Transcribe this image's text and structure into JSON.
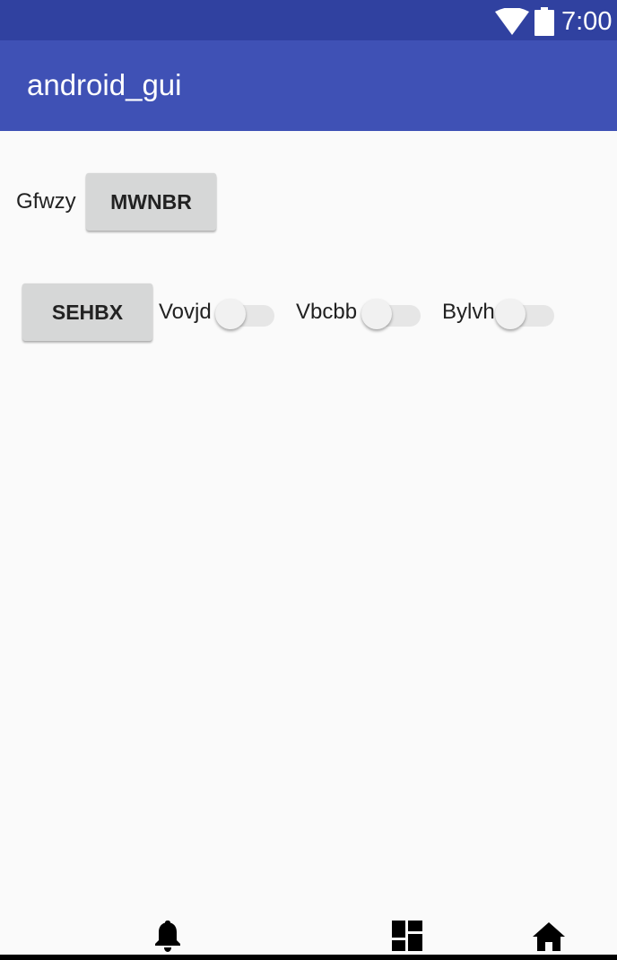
{
  "status_bar": {
    "time": "7:00",
    "icons": [
      "wifi-icon",
      "battery-icon"
    ],
    "color": "#3041a0"
  },
  "app_bar": {
    "title": "android_gui",
    "color": "#3f51b5"
  },
  "row1": {
    "label": "Gfwzy",
    "button": "MWNBR"
  },
  "row2": {
    "button": "SEHBX",
    "switches": [
      {
        "label": "Vovjd",
        "checked": false
      },
      {
        "label": "Vbcbb",
        "checked": false
      },
      {
        "label": "Bylvh",
        "checked": false
      }
    ]
  },
  "nav_bar": {
    "icons": [
      "bell-icon",
      "dashboard-icon",
      "home-icon"
    ]
  }
}
